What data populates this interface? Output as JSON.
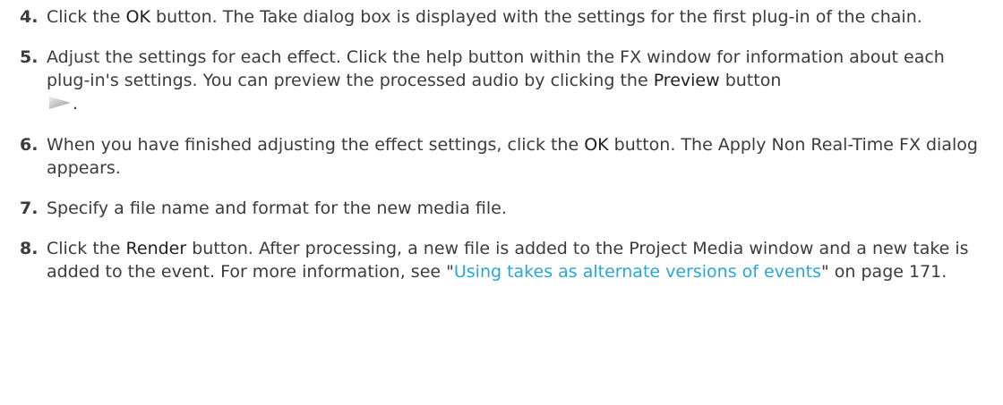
{
  "steps": [
    {
      "number": "4.",
      "t1": "Click the ",
      "b1": "OK",
      "t2": " button. The Take dialog box is displayed with the settings for the first plug-in of the chain."
    },
    {
      "number": "5.",
      "t1": "Adjust the settings for each effect. Click the help button within the FX window for information about each plug-in's settings. You can preview the processed audio by clicking the ",
      "b1": "Preview",
      "t2": " button",
      "icon": "play-triangle-icon",
      "t3": "."
    },
    {
      "number": "6.",
      "t1": "When you have finished adjusting the effect settings, click the ",
      "b1": "OK",
      "t2": " button. The Apply Non Real-Time FX dialog appears."
    },
    {
      "number": "7.",
      "t1": "Specify a file name and format for the new media file."
    },
    {
      "number": "8.",
      "t1": "Click the ",
      "b1": "Render",
      "t2": " button. After processing, a new file is added to the Project Media window and a new take is added to the event. For more information, see \"",
      "link": "Using takes as alternate versions of events",
      "t3": "\" on page 171."
    }
  ],
  "colors": {
    "text": "#3b3b3b",
    "link": "#2aa6d1",
    "icon_light": "#e6e6e6",
    "icon_dark": "#9a9a9a"
  }
}
